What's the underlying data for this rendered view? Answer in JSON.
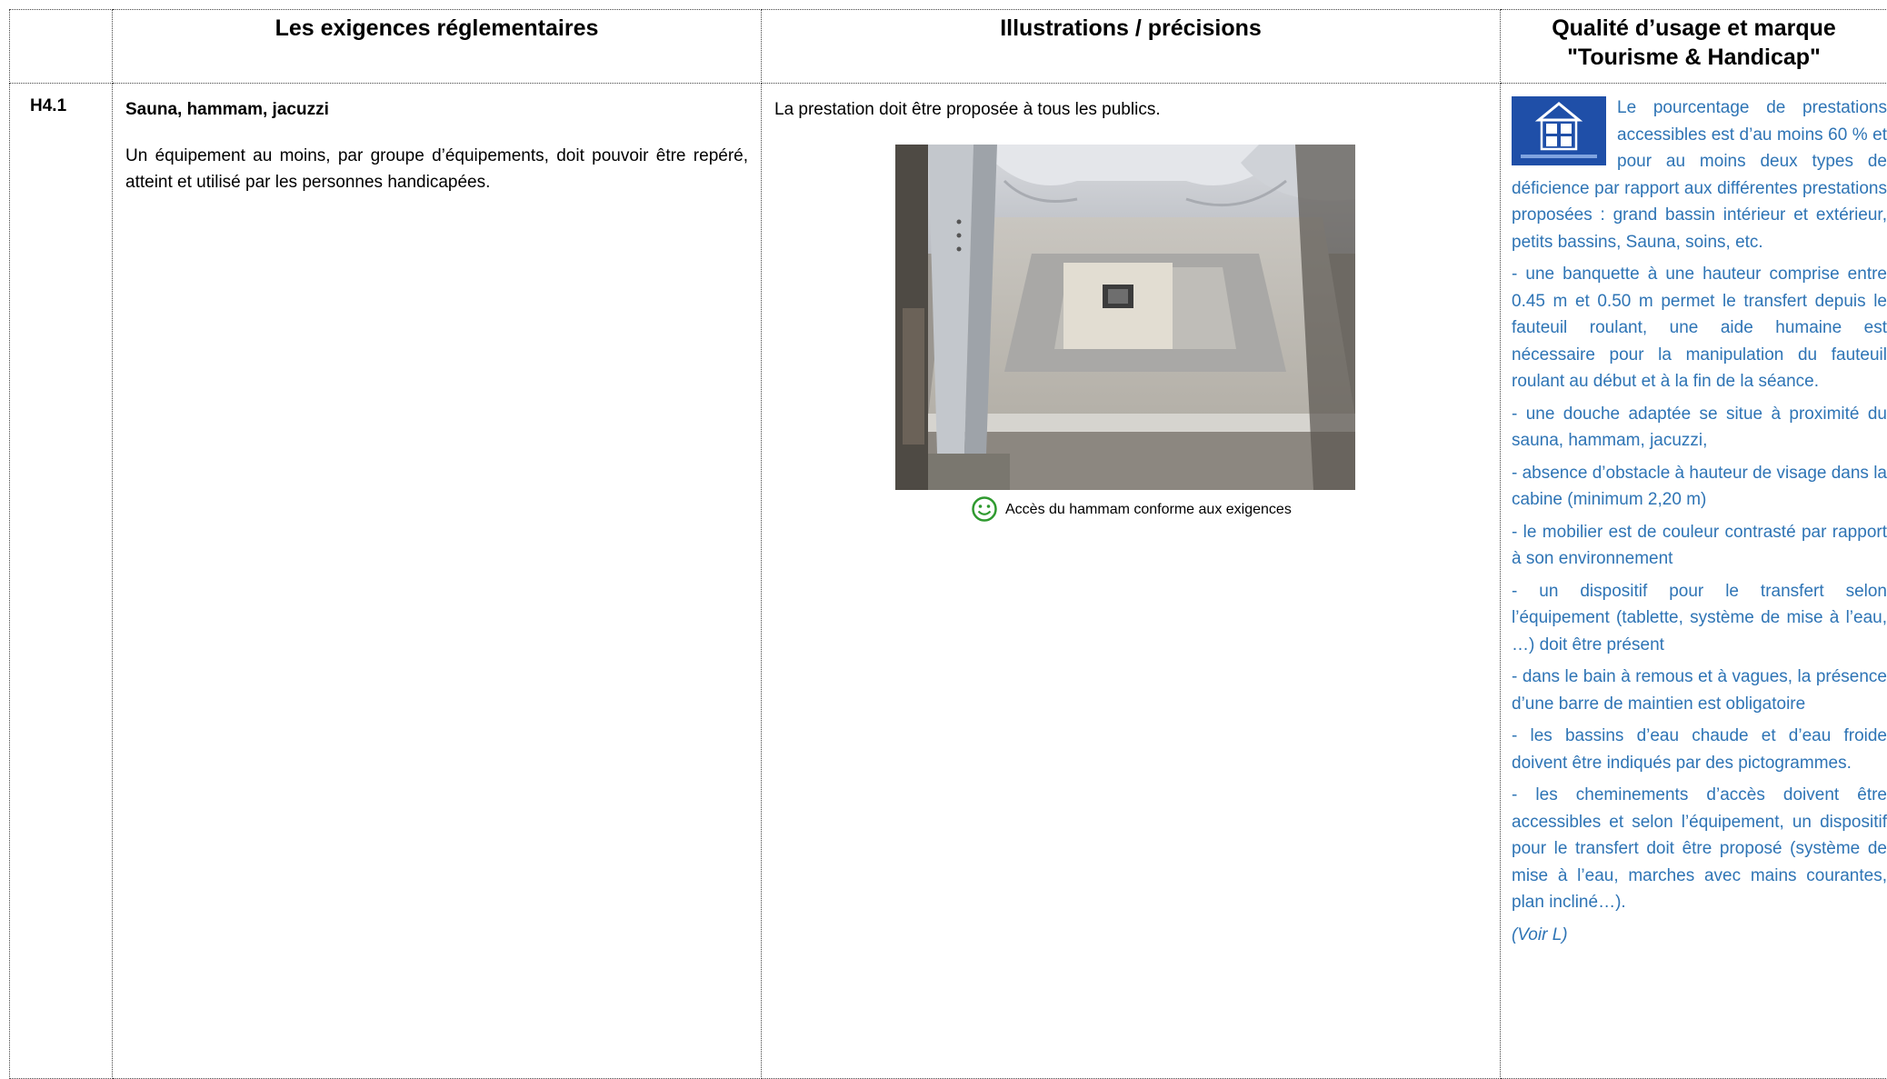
{
  "headers": {
    "col1": "",
    "col2": "Les exigences réglementaires",
    "col3": "Illustrations / précisions",
    "col4_line1": "Qualité d’usage et marque",
    "col4_line2": "\"Tourisme & Handicap\""
  },
  "row": {
    "code": "H4.1",
    "req_title": "Sauna, hammam, jacuzzi",
    "req_text": "Un équipement au moins, par groupe d’équipements, doit pouvoir être repéré, atteint et utilisé par les personnes handicapées.",
    "ill_text": "La prestation doit être proposée à tous les publics.",
    "photo_icon": "hammam-entrance-photo",
    "caption_icon": "smiley-icon",
    "caption": "Accès du hammam conforme aux exigences",
    "logo_icon": "tourisme-handicap-logo",
    "quality": [
      "Le pourcentage de prestations accessibles est d’au moins 60 % et pour au moins deux types de déficience par rapport aux différentes prestations proposées : grand bassin intérieur et extérieur, petits bassins, Sauna, soins, etc.",
      "- une banquette à une hauteur comprise entre 0.45 m et 0.50 m permet le transfert depuis le fauteuil roulant, une aide humaine est nécessaire pour la manipulation du fauteuil roulant au début et à la fin de la séance.",
      "- une douche adaptée se situe à proximité du sauna, hammam, jacuzzi,",
      "- absence d’obstacle à hauteur de visage dans la cabine (minimum 2,20 m)",
      "- le mobilier est de couleur contrasté par rapport à son environnement",
      "- un dispositif pour le transfert selon l’équipement (tablette, système de mise à l’eau, …) doit être présent",
      "- dans le bain à remous et à vagues, la présence d’une barre de maintien est obligatoire",
      "- les bassins d’eau chaude et d’eau froide doivent être indiqués par des pictogrammes.",
      "- les cheminements d’accès doivent être accessibles et selon l’équipement, un dispositif pour le transfert doit être proposé (système de mise à l’eau, marches avec mains courantes, plan incliné…)."
    ],
    "voir": "(Voir L)"
  },
  "colors": {
    "quality_text": "#2e74b5",
    "logo_blue": "#1f4fa8",
    "smiley_green": "#2f9a2f"
  }
}
